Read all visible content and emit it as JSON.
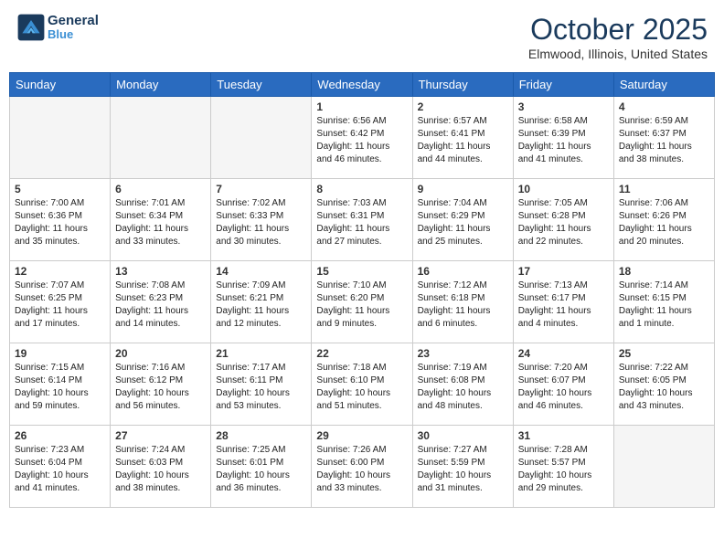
{
  "logo": {
    "text_line1": "General",
    "text_line2": "Blue"
  },
  "title": "October 2025",
  "location": "Elmwood, Illinois, United States",
  "weekdays": [
    "Sunday",
    "Monday",
    "Tuesday",
    "Wednesday",
    "Thursday",
    "Friday",
    "Saturday"
  ],
  "weeks": [
    [
      {
        "day": "",
        "info": ""
      },
      {
        "day": "",
        "info": ""
      },
      {
        "day": "",
        "info": ""
      },
      {
        "day": "1",
        "info": "Sunrise: 6:56 AM\nSunset: 6:42 PM\nDaylight: 11 hours and 46 minutes."
      },
      {
        "day": "2",
        "info": "Sunrise: 6:57 AM\nSunset: 6:41 PM\nDaylight: 11 hours and 44 minutes."
      },
      {
        "day": "3",
        "info": "Sunrise: 6:58 AM\nSunset: 6:39 PM\nDaylight: 11 hours and 41 minutes."
      },
      {
        "day": "4",
        "info": "Sunrise: 6:59 AM\nSunset: 6:37 PM\nDaylight: 11 hours and 38 minutes."
      }
    ],
    [
      {
        "day": "5",
        "info": "Sunrise: 7:00 AM\nSunset: 6:36 PM\nDaylight: 11 hours and 35 minutes."
      },
      {
        "day": "6",
        "info": "Sunrise: 7:01 AM\nSunset: 6:34 PM\nDaylight: 11 hours and 33 minutes."
      },
      {
        "day": "7",
        "info": "Sunrise: 7:02 AM\nSunset: 6:33 PM\nDaylight: 11 hours and 30 minutes."
      },
      {
        "day": "8",
        "info": "Sunrise: 7:03 AM\nSunset: 6:31 PM\nDaylight: 11 hours and 27 minutes."
      },
      {
        "day": "9",
        "info": "Sunrise: 7:04 AM\nSunset: 6:29 PM\nDaylight: 11 hours and 25 minutes."
      },
      {
        "day": "10",
        "info": "Sunrise: 7:05 AM\nSunset: 6:28 PM\nDaylight: 11 hours and 22 minutes."
      },
      {
        "day": "11",
        "info": "Sunrise: 7:06 AM\nSunset: 6:26 PM\nDaylight: 11 hours and 20 minutes."
      }
    ],
    [
      {
        "day": "12",
        "info": "Sunrise: 7:07 AM\nSunset: 6:25 PM\nDaylight: 11 hours and 17 minutes."
      },
      {
        "day": "13",
        "info": "Sunrise: 7:08 AM\nSunset: 6:23 PM\nDaylight: 11 hours and 14 minutes."
      },
      {
        "day": "14",
        "info": "Sunrise: 7:09 AM\nSunset: 6:21 PM\nDaylight: 11 hours and 12 minutes."
      },
      {
        "day": "15",
        "info": "Sunrise: 7:10 AM\nSunset: 6:20 PM\nDaylight: 11 hours and 9 minutes."
      },
      {
        "day": "16",
        "info": "Sunrise: 7:12 AM\nSunset: 6:18 PM\nDaylight: 11 hours and 6 minutes."
      },
      {
        "day": "17",
        "info": "Sunrise: 7:13 AM\nSunset: 6:17 PM\nDaylight: 11 hours and 4 minutes."
      },
      {
        "day": "18",
        "info": "Sunrise: 7:14 AM\nSunset: 6:15 PM\nDaylight: 11 hours and 1 minute."
      }
    ],
    [
      {
        "day": "19",
        "info": "Sunrise: 7:15 AM\nSunset: 6:14 PM\nDaylight: 10 hours and 59 minutes."
      },
      {
        "day": "20",
        "info": "Sunrise: 7:16 AM\nSunset: 6:12 PM\nDaylight: 10 hours and 56 minutes."
      },
      {
        "day": "21",
        "info": "Sunrise: 7:17 AM\nSunset: 6:11 PM\nDaylight: 10 hours and 53 minutes."
      },
      {
        "day": "22",
        "info": "Sunrise: 7:18 AM\nSunset: 6:10 PM\nDaylight: 10 hours and 51 minutes."
      },
      {
        "day": "23",
        "info": "Sunrise: 7:19 AM\nSunset: 6:08 PM\nDaylight: 10 hours and 48 minutes."
      },
      {
        "day": "24",
        "info": "Sunrise: 7:20 AM\nSunset: 6:07 PM\nDaylight: 10 hours and 46 minutes."
      },
      {
        "day": "25",
        "info": "Sunrise: 7:22 AM\nSunset: 6:05 PM\nDaylight: 10 hours and 43 minutes."
      }
    ],
    [
      {
        "day": "26",
        "info": "Sunrise: 7:23 AM\nSunset: 6:04 PM\nDaylight: 10 hours and 41 minutes."
      },
      {
        "day": "27",
        "info": "Sunrise: 7:24 AM\nSunset: 6:03 PM\nDaylight: 10 hours and 38 minutes."
      },
      {
        "day": "28",
        "info": "Sunrise: 7:25 AM\nSunset: 6:01 PM\nDaylight: 10 hours and 36 minutes."
      },
      {
        "day": "29",
        "info": "Sunrise: 7:26 AM\nSunset: 6:00 PM\nDaylight: 10 hours and 33 minutes."
      },
      {
        "day": "30",
        "info": "Sunrise: 7:27 AM\nSunset: 5:59 PM\nDaylight: 10 hours and 31 minutes."
      },
      {
        "day": "31",
        "info": "Sunrise: 7:28 AM\nSunset: 5:57 PM\nDaylight: 10 hours and 29 minutes."
      },
      {
        "day": "",
        "info": ""
      }
    ]
  ]
}
